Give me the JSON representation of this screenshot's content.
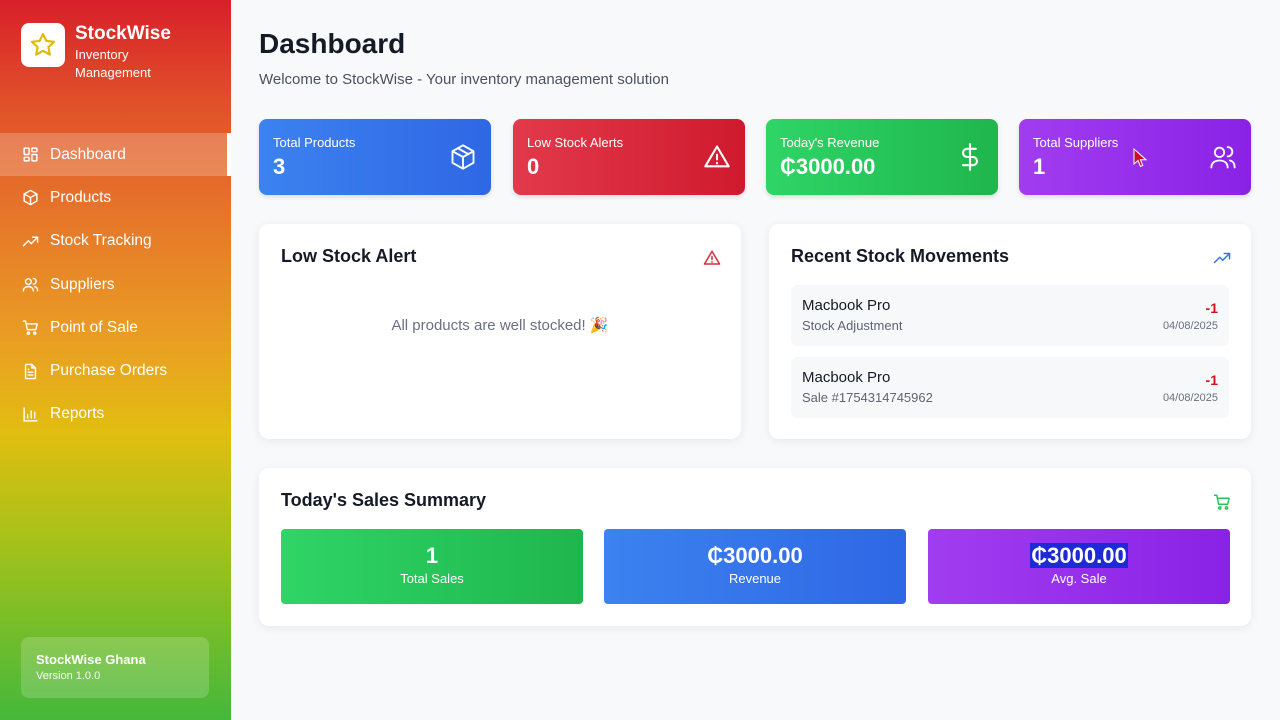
{
  "brand": {
    "name": "StockWise",
    "subtitle": "Inventory Management",
    "logo_icon": "star-icon"
  },
  "nav": [
    {
      "label": "Dashboard",
      "icon": "grid-icon",
      "active": true
    },
    {
      "label": "Products",
      "icon": "box-icon"
    },
    {
      "label": "Stock Tracking",
      "icon": "trend-icon"
    },
    {
      "label": "Suppliers",
      "icon": "users-icon"
    },
    {
      "label": "Point of Sale",
      "icon": "cart-icon"
    },
    {
      "label": "Purchase Orders",
      "icon": "document-icon"
    },
    {
      "label": "Reports",
      "icon": "bar-chart-icon"
    }
  ],
  "footer": {
    "name": "StockWise Ghana",
    "version": "Version 1.0.0"
  },
  "header": {
    "title": "Dashboard",
    "subtitle": "Welcome to StockWise - Your inventory management solution"
  },
  "stats": [
    {
      "label": "Total Products",
      "value": "3",
      "icon": "box-icon",
      "color": "#3474ea"
    },
    {
      "label": "Low Stock Alerts",
      "value": "0",
      "icon": "warning-icon",
      "color": "#d92a3c"
    },
    {
      "label": "Today's Revenue",
      "value": "₵3000.00",
      "icon": "dollar-icon",
      "color": "#27c559"
    },
    {
      "label": "Total Suppliers",
      "value": "1",
      "icon": "users-icon",
      "color": "#962feb"
    }
  ],
  "low_stock": {
    "title": "Low Stock Alert",
    "message": "All products are well stocked! 🎉",
    "icon": "warning-icon"
  },
  "movements": {
    "title": "Recent Stock Movements",
    "icon": "trend-icon",
    "items": [
      {
        "name": "Macbook Pro",
        "type": "Stock Adjustment",
        "qty": "-1",
        "date": "04/08/2025"
      },
      {
        "name": "Macbook Pro",
        "type": "Sale #1754314745962",
        "qty": "-1",
        "date": "04/08/2025"
      }
    ]
  },
  "sales_summary": {
    "title": "Today's Sales Summary",
    "icon": "cart-icon",
    "items": [
      {
        "value": "1",
        "label": "Total Sales"
      },
      {
        "value": "₵3000.00",
        "label": "Revenue"
      },
      {
        "value": "₵3000.00",
        "label": "Avg. Sale"
      }
    ]
  }
}
